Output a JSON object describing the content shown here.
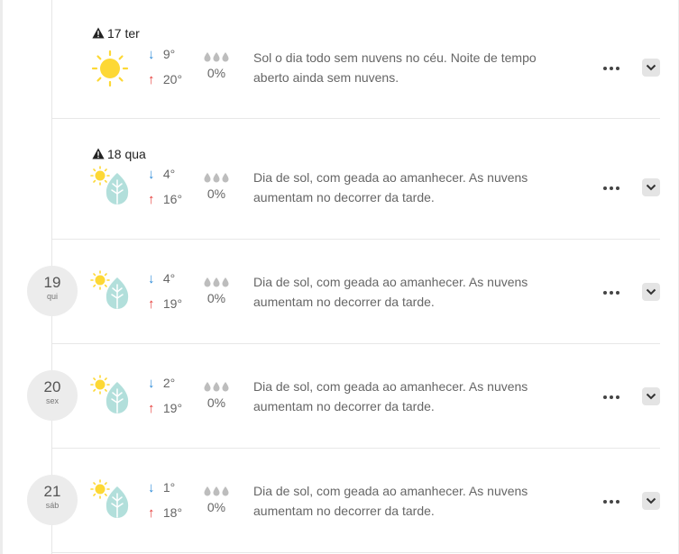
{
  "days": [
    {
      "type": "alert",
      "date_label": "17 ter",
      "icon": "sun-icon",
      "min": "9°",
      "max": "20°",
      "precip": "0%",
      "desc_line1": "Sol o dia todo sem nuvens no céu. Noite de tempo",
      "desc_line2": "aberto ainda sem nuvens."
    },
    {
      "type": "alert",
      "date_label": "18 qua",
      "icon": "sun-frost-leaf-icon",
      "min": "4°",
      "max": "16°",
      "precip": "0%",
      "desc_line1": "Dia de sol, com geada ao amanhecer. As nuvens",
      "desc_line2": "aumentam no decorrer da tarde."
    },
    {
      "type": "badge",
      "day_num": "19",
      "weekday": "qui",
      "icon": "sun-frost-leaf-icon",
      "min": "4°",
      "max": "19°",
      "precip": "0%",
      "desc_line1": "Dia de sol, com geada ao amanhecer. As nuvens",
      "desc_line2": "aumentam no decorrer da tarde."
    },
    {
      "type": "badge",
      "day_num": "20",
      "weekday": "sex",
      "icon": "sun-frost-leaf-icon",
      "min": "2°",
      "max": "19°",
      "precip": "0%",
      "desc_line1": "Dia de sol, com geada ao amanhecer. As nuvens",
      "desc_line2": "aumentam no decorrer da tarde."
    },
    {
      "type": "badge",
      "day_num": "21",
      "weekday": "sáb",
      "icon": "sun-frost-leaf-icon",
      "min": "1°",
      "max": "18°",
      "precip": "0%",
      "desc_line1": "Dia de sol, com geada ao amanhecer. As nuvens",
      "desc_line2": "aumentam no decorrer da tarde."
    }
  ],
  "colors": {
    "min_arrow": "#2b8ad8",
    "max_arrow": "#e53935",
    "sun": "#fdd835",
    "leaf": "#b2dfdb"
  }
}
